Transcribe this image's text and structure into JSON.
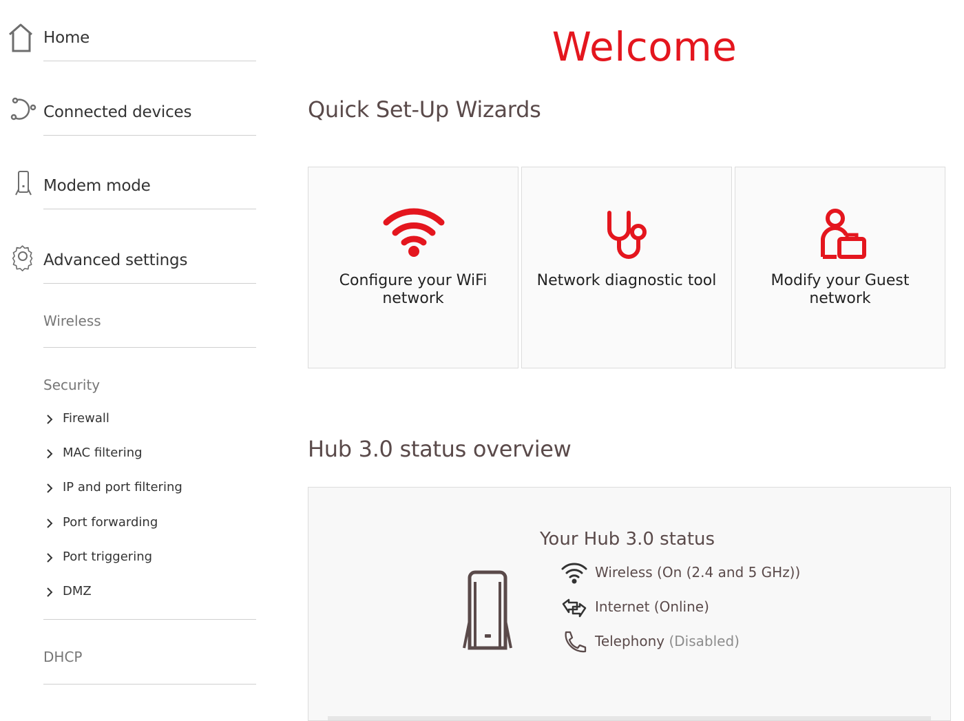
{
  "colors": {
    "accent": "#e4161e",
    "text": "#333333",
    "muted": "#777777",
    "icon_gray": "#6d6d6d"
  },
  "sidebar": {
    "main_items": [
      {
        "label": "Home",
        "icon": "home-icon"
      },
      {
        "label": "Connected devices",
        "icon": "connected-devices-icon"
      },
      {
        "label": "Modem mode",
        "icon": "modem-icon"
      },
      {
        "label": "Advanced settings",
        "icon": "gear-icon"
      }
    ],
    "wireless_label": "Wireless",
    "security": {
      "label": "Security",
      "items": [
        "Firewall",
        "MAC filtering",
        "IP and port filtering",
        "Port forwarding",
        "Port triggering",
        "DMZ"
      ]
    },
    "dhcp_label": "DHCP"
  },
  "main": {
    "welcome": "Welcome",
    "wizards_title": "Quick Set-Up Wizards",
    "wizards": [
      {
        "label": "Configure your WiFi network",
        "icon": "wifi-icon"
      },
      {
        "label": "Network diagnostic tool",
        "icon": "stethoscope-icon"
      },
      {
        "label": "Modify your Guest network",
        "icon": "guest-user-icon"
      }
    ],
    "status_title": "Hub 3.0 status overview",
    "status": {
      "heading": "Your Hub 3.0 status",
      "wireless": "Wireless (On (2.4 and 5 GHz))",
      "internet": "Internet (Online)",
      "telephony_label": "Telephony",
      "telephony_state": "(Disabled)"
    }
  }
}
